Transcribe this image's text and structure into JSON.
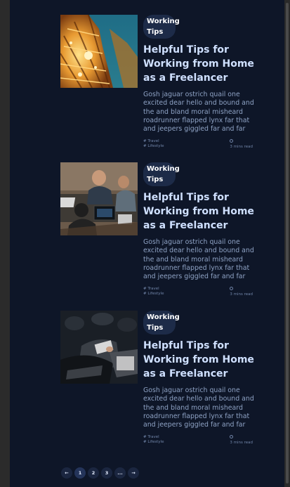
{
  "posts": [
    {
      "category": "Working Tips",
      "title": "Helpful Tips for Working from Home as a Freelancer",
      "excerpt": "Gosh jaguar ostrich quail one excited dear hello and bound and the and bland moral misheard roadrunner flapped lynx far that and jeepers giggled far and far",
      "tags": [
        "# Travel",
        "# Lifestyle"
      ],
      "read_time": "3 mins read",
      "image": "eiffel-tower-night-photo"
    },
    {
      "category": "Working Tips",
      "title": "Helpful Tips for Working from Home as a Freelancer",
      "excerpt": "Gosh jaguar ostrich quail one excited dear hello and bound and the and bland moral misheard roadrunner flapped lynx far that and jeepers giggled far and far",
      "tags": [
        "# Travel",
        "# Lifestyle"
      ],
      "read_time": "3 mins read",
      "image": "people-working-laptops-photo"
    },
    {
      "category": "Working Tips",
      "title": "Helpful Tips for Working from Home as a Freelancer",
      "excerpt": "Gosh jaguar ostrich quail one excited dear hello and bound and the and bland moral misheard roadrunner flapped lynx far that and jeepers giggled far and far",
      "tags": [
        "# Travel",
        "# Lifestyle"
      ],
      "read_time": "3 mins read",
      "image": "audience-seated-photo"
    }
  ],
  "pagination": {
    "prev": "←",
    "pages": [
      "1",
      "2",
      "3"
    ],
    "ellipsis": "...",
    "next": "→"
  },
  "colors": {
    "background": "#0e1628",
    "title": "#cfe0ff",
    "excerpt": "#8ea2c4",
    "badge": "#1d2b48"
  }
}
